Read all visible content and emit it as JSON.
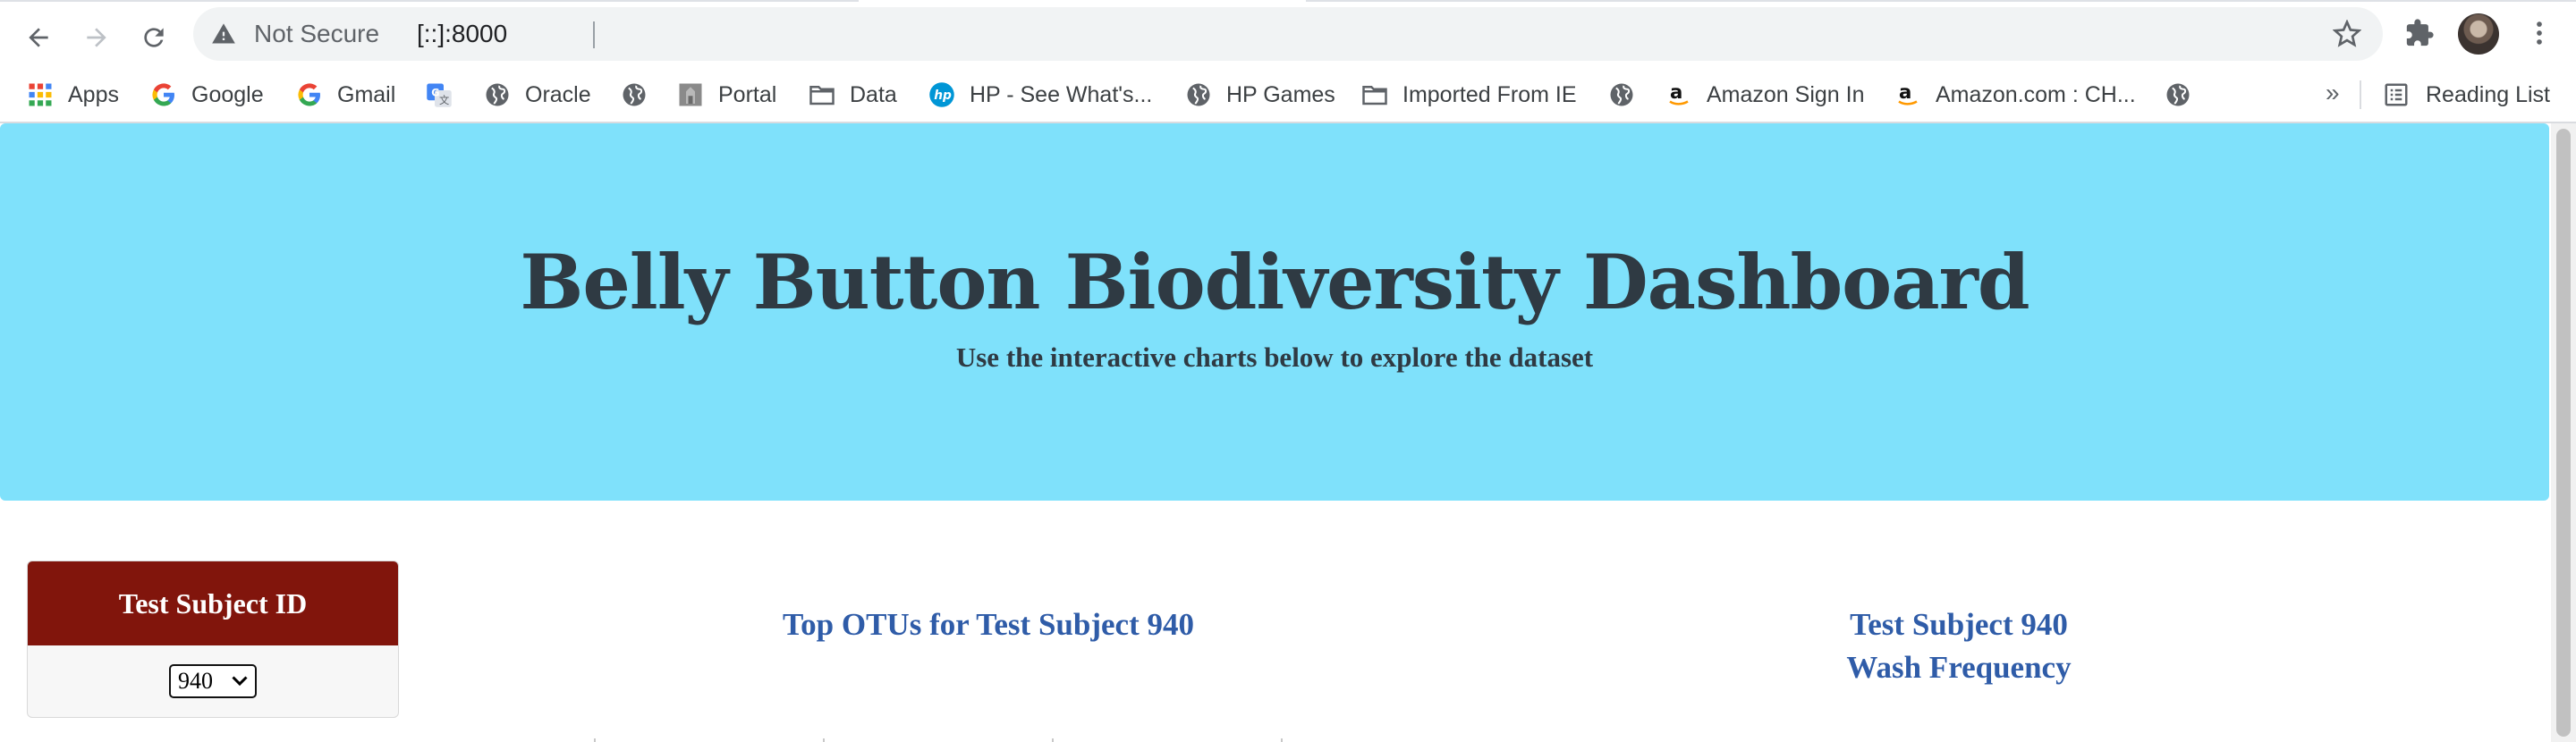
{
  "browser": {
    "security_label": "Not Secure",
    "url": "[::]:8000",
    "reading_list_label": "Reading List",
    "overflow_glyph": "»",
    "bookmarks": [
      {
        "label": "Apps",
        "icon": "apps-grid-icon"
      },
      {
        "label": "Google",
        "icon": "google-icon"
      },
      {
        "label": "Gmail",
        "icon": "google-icon"
      },
      {
        "label": "",
        "icon": "translate-icon"
      },
      {
        "label": "Oracle",
        "icon": "globe-icon"
      },
      {
        "label": "",
        "icon": "globe-icon"
      },
      {
        "label": "Portal",
        "icon": "portal-icon"
      },
      {
        "label": "Data",
        "icon": "folder-icon"
      },
      {
        "label": "HP - See What's...",
        "icon": "hp-icon"
      },
      {
        "label": "HP Games",
        "icon": "globe-icon"
      },
      {
        "label": "Imported From IE",
        "icon": "folder-icon"
      },
      {
        "label": "",
        "icon": "globe-icon"
      },
      {
        "label": "Amazon Sign In",
        "icon": "amazon-icon"
      },
      {
        "label": "Amazon.com : CH...",
        "icon": "amazon-icon"
      },
      {
        "label": "",
        "icon": "globe-icon"
      }
    ]
  },
  "page": {
    "title": "Belly Button Biodiversity Dashboard",
    "subtitle": "Use the interactive charts below to explore the dataset",
    "selector_panel": {
      "heading": "Test Subject ID",
      "selected_value": "940"
    },
    "bar_chart_title": "Top OTUs for Test Subject 940",
    "gauge_chart_title_line1": "Test Subject 940",
    "gauge_chart_title_line2": "Wash Frequency"
  },
  "colors": {
    "jumbotron": "#7fe1fb",
    "panel_header": "#81150c",
    "chart_title": "#2f5ca8",
    "heading_text": "#2f3a43"
  }
}
